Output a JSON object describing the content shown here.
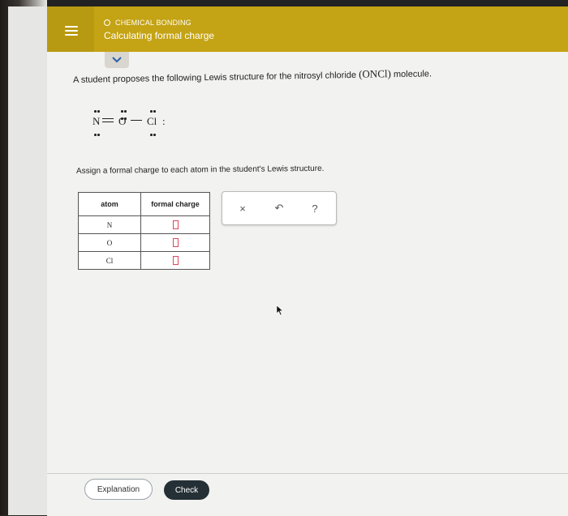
{
  "header": {
    "topic": "CHEMICAL BONDING",
    "title": "Calculating formal charge"
  },
  "question": {
    "text_before": "A student proposes the following Lewis structure for the nitrosyl chloride",
    "formula": "(ONCl)",
    "text_after": "molecule."
  },
  "lewis_structure": {
    "atoms": [
      "N",
      "O",
      "Cl"
    ],
    "colon": ":"
  },
  "instruction": "Assign a formal charge to each atom in the student's Lewis structure.",
  "table": {
    "headers": [
      "atom",
      "formal charge"
    ],
    "rows": [
      {
        "atom": "N",
        "formal_charge": ""
      },
      {
        "atom": "O",
        "formal_charge": ""
      },
      {
        "atom": "Cl",
        "formal_charge": ""
      }
    ]
  },
  "tools": {
    "clear_label": "×",
    "undo_label": "↶",
    "help_label": "?"
  },
  "footer": {
    "explanation_label": "Explanation",
    "check_label": "Check"
  },
  "colors": {
    "header": "#c4a314",
    "input_border": "#e0445a",
    "check_button": "#243036"
  }
}
